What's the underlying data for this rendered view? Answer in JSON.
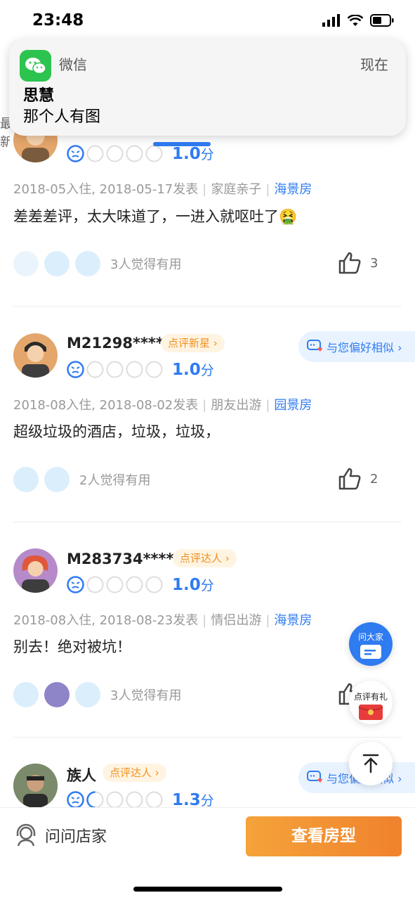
{
  "status_bar": {
    "time": "23:48"
  },
  "notification": {
    "app": "微信",
    "time": "现在",
    "sender": "思慧",
    "message": "那个人有图"
  },
  "reviews": [
    {
      "score": "1.0",
      "score_unit": "分",
      "meta_dates": "2018-05入住, 2018-05-17发表",
      "trip_type": "家庭亲子",
      "room_type": "海景房",
      "content": "差差差评，太大味道了，一进入就呕吐了🤮",
      "helpful_text": "3人觉得有用",
      "like_count": "3"
    },
    {
      "username": "M21298****",
      "badge": "点评新星 ›",
      "similar": "与您偏好相似 ›",
      "score": "1.0",
      "score_unit": "分",
      "meta_dates": "2018-08入住, 2018-08-02发表",
      "trip_type": "朋友出游",
      "room_type": "园景房",
      "content": "超级垃圾的酒店，垃圾，垃圾，",
      "helpful_text": "2人觉得有用",
      "like_count": "2"
    },
    {
      "username": "M283734****",
      "badge": "点评达人 ›",
      "score": "1.0",
      "score_unit": "分",
      "meta_dates": "2018-08入住, 2018-08-23发表",
      "trip_type": "情侣出游",
      "room_type": "海景房",
      "content": "别去！绝对被坑！",
      "helpful_text": "3人觉得有用"
    },
    {
      "username": "族人",
      "badge": "点评达人 ›",
      "similar": "与您偏好相似 ›",
      "score": "1.3",
      "score_unit": "分"
    }
  ],
  "float_buttons": {
    "ask_everyone": "问大家",
    "review_gift": "点评有礼"
  },
  "bottom_bar": {
    "ask_store": "问问店家",
    "view_rooms": "查看房型"
  },
  "colors": {
    "accent": "#2f7bf0",
    "orange": "#f0822d",
    "badge_text": "#f0901f"
  }
}
